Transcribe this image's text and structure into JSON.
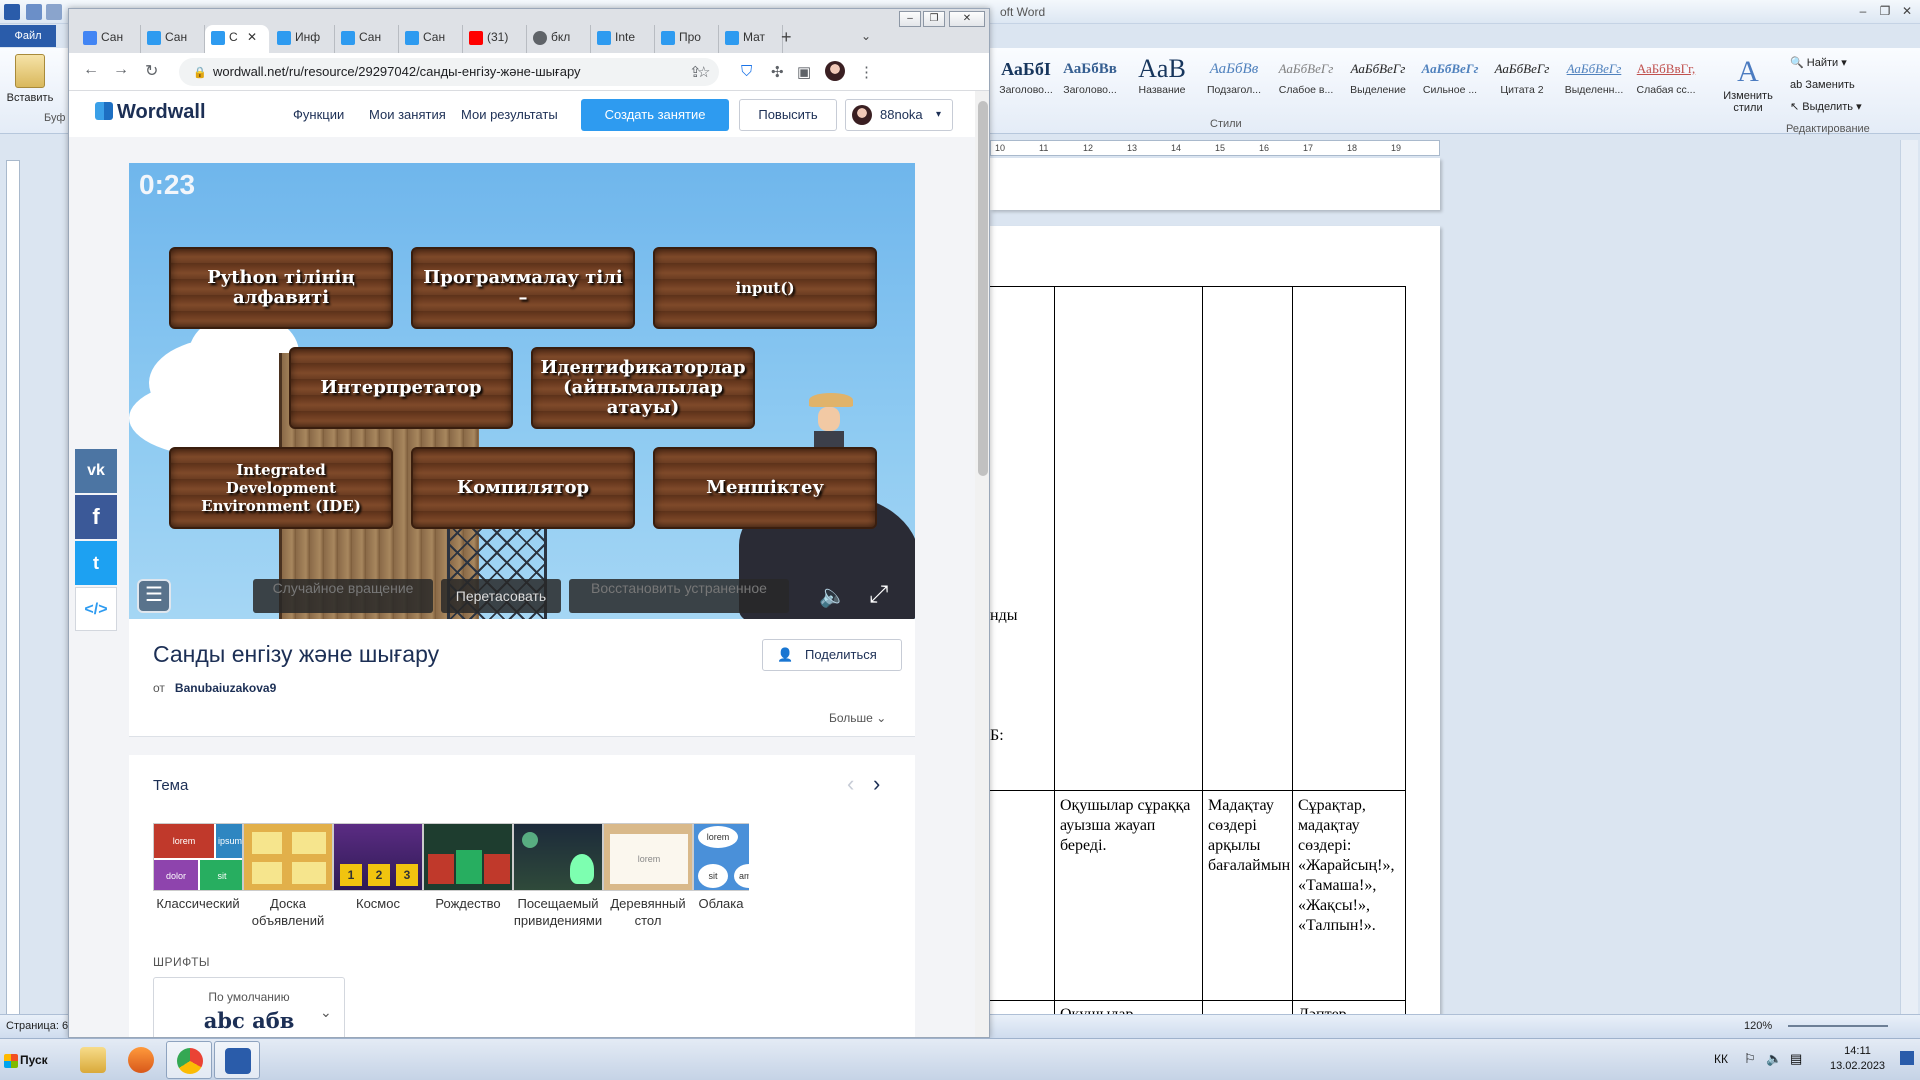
{
  "word": {
    "title": "oft Word",
    "file_tab": "Файл",
    "paste_label": "Вставить",
    "clipboard_short": "Буф",
    "styles": [
      {
        "sample": "АаБбI",
        "name": "Заголово..."
      },
      {
        "sample": "АаБбВв",
        "name": "Заголово..."
      },
      {
        "sample": "AaB",
        "name": "Название"
      },
      {
        "sample": "АаБбВв",
        "name": "Подзагол..."
      },
      {
        "sample": "АаБбВеГг",
        "name": "Слабое в..."
      },
      {
        "sample": "АаБбВеГг",
        "name": "Выделение"
      },
      {
        "sample": "АаБбВеГг",
        "name": "Сильное ..."
      },
      {
        "sample": "АаБбВеГг",
        "name": "Цитата 2"
      },
      {
        "sample": "АаБбВеГг",
        "name": "Выделенн..."
      },
      {
        "sample": "АаБбВвГг,",
        "name": "Слабая сс..."
      }
    ],
    "styles_group": "Стили",
    "change_styles": "Изменить стили",
    "find": "Найти",
    "replace": "Заменить",
    "select": "Выделить",
    "editing_group": "Редактирование",
    "ruler_marks": [
      "10",
      "11",
      "12",
      "13",
      "14",
      "15",
      "16",
      "17",
      "18",
      "19"
    ],
    "cell_fragment_1": "нды",
    "cell_fragment_2": "Б:",
    "cell_students_answer": "Оқушылар сұраққа ауызша жауап береді.",
    "cell_praise": "Мадақтау сөздері арқылы бағалаймын",
    "cell_questions": "Сұрақтар, мадақтау сөздері: «Жарайсың!», «Тамаша!», «Жақсы!», «Талпын!».",
    "cell_bottom_1": "Оқушылар",
    "cell_bottom_2": "Дәптер",
    "status_page": "Страница: 6",
    "zoom": "120%"
  },
  "browser": {
    "tabs": [
      {
        "label": "Сан",
        "color": "#4285f4"
      },
      {
        "label": "Сан",
        "color": "#2e9bf0"
      },
      {
        "label": "С",
        "color": "#2e9bf0"
      },
      {
        "label": "Инф",
        "color": "#2e9bf0"
      },
      {
        "label": "Сан",
        "color": "#2e9bf0"
      },
      {
        "label": "Сан",
        "color": "#2e9bf0"
      },
      {
        "label": "(31)",
        "color": "#ff0000"
      },
      {
        "label": "бкл",
        "color": "#5f6368"
      },
      {
        "label": "Inte",
        "color": "#2e9bf0"
      },
      {
        "label": "Про",
        "color": "#2e9bf0"
      },
      {
        "label": "Мат",
        "color": "#2e9bf0"
      }
    ],
    "url": "wordwall.net/ru/resource/29297042/санды-енгізу-және-шығару"
  },
  "wordwall": {
    "logo": "Wordwall",
    "nav": [
      "Функции",
      "Мои занятия",
      "Мои результаты"
    ],
    "create_button": "Создать занятие",
    "upgrade_button": "Повысить",
    "user_name": "88noka",
    "timer": "0:23",
    "planks": [
      "Python тілінің алфавиті",
      "Программалау тілі –",
      "input()",
      "Интерпретатор",
      "Идентификаторлар (айнымалылар атауы)",
      "Integrated Development Environment (IDE)",
      "Компилятор",
      "Меншіктеу"
    ],
    "game_buttons": {
      "random_spin": "Случайное вращение",
      "shuffle": "Перетасовать",
      "restore": "Восстановить устраненное"
    },
    "social": [
      "vk",
      "f",
      "t",
      "</>"
    ],
    "activity_title": "Санды енгізу және шығару",
    "author_prefix": "от",
    "author": "Banubaiuzakova9",
    "share_button": "Поделиться",
    "more": "Больше",
    "theme_title": "Тема",
    "themes": [
      "Классический",
      "Доска объявлений",
      "Космос",
      "Рождество",
      "Посещаемый привидениями",
      "Деревянный стол",
      "Облака"
    ],
    "theme_thumb_words": {
      "lorem": "lorem",
      "ipsum": "ipsum",
      "dolor": "dolor",
      "sit": "sit",
      "amet": "amet",
      "n1": "1",
      "n2": "2",
      "n3": "3"
    },
    "fonts_title": "ШРИФТЫ",
    "font_default_label": "По умолчанию",
    "font_sample": "abc абв"
  },
  "taskbar": {
    "start": "Пуск",
    "lang": "КК",
    "time": "14:11",
    "date": "13.02.2023"
  }
}
